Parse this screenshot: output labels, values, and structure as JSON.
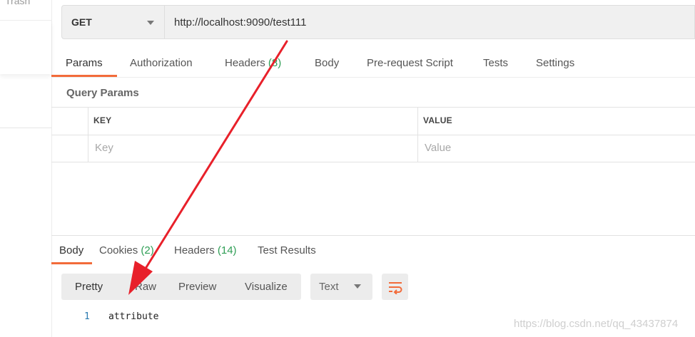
{
  "sidebar": {
    "trash_label": "Trash"
  },
  "request": {
    "method": "GET",
    "url": "http://localhost:9090/test111"
  },
  "request_tabs": [
    {
      "label": "Params",
      "count": "",
      "active": true
    },
    {
      "label": "Authorization",
      "count": "",
      "active": false
    },
    {
      "label": "Headers",
      "count": "(8)",
      "active": false
    },
    {
      "label": "Body",
      "count": "",
      "active": false
    },
    {
      "label": "Pre-request Script",
      "count": "",
      "active": false
    },
    {
      "label": "Tests",
      "count": "",
      "active": false
    },
    {
      "label": "Settings",
      "count": "",
      "active": false
    }
  ],
  "query_params": {
    "title": "Query Params",
    "columns": [
      "KEY",
      "VALUE"
    ],
    "placeholder_row": {
      "key": "Key",
      "value": "Value"
    }
  },
  "response_tabs": [
    {
      "label": "Body",
      "count": "",
      "active": true
    },
    {
      "label": "Cookies",
      "count": "(2)",
      "active": false
    },
    {
      "label": "Headers",
      "count": "(14)",
      "active": false
    },
    {
      "label": "Test Results",
      "count": "",
      "active": false
    }
  ],
  "body_views": {
    "options": [
      "Pretty",
      "Raw",
      "Preview",
      "Visualize"
    ],
    "selected": "Pretty",
    "format": "Text"
  },
  "response_body": {
    "lines": [
      {
        "number": "1",
        "text": "attribute"
      }
    ]
  },
  "watermark": "https://blog.csdn.net/qq_43437874",
  "icons": {
    "method_dropdown": "chevron-down-icon",
    "format_dropdown": "chevron-down-icon",
    "wrap": "wrap-lines-icon"
  },
  "colors": {
    "accent": "#f26b3a",
    "count_green": "#2f9e55",
    "annotation_arrow": "#e8202a",
    "line_number": "#2a7ab0"
  }
}
